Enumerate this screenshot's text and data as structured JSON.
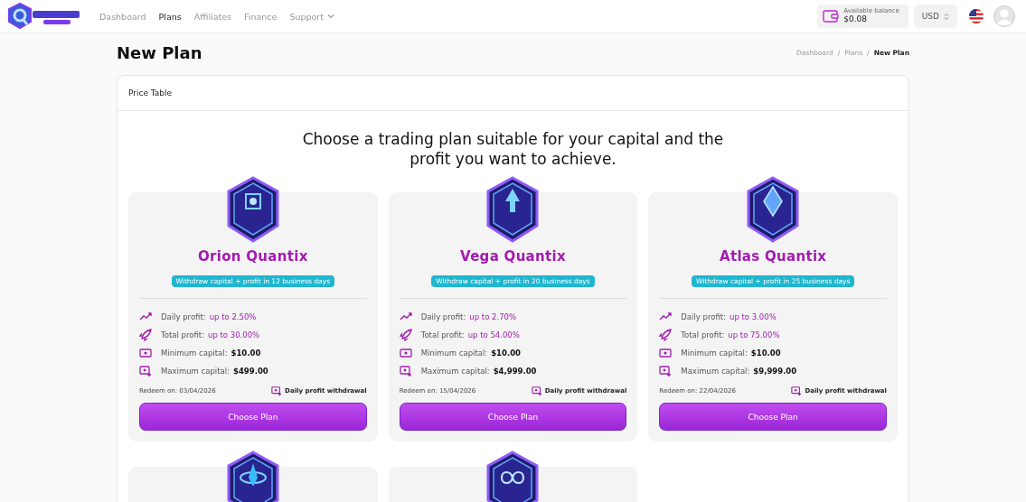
{
  "nav": {
    "items": [
      {
        "label": "Dashboard",
        "selected": false,
        "dropdown": false
      },
      {
        "label": "Plans",
        "selected": true,
        "dropdown": false
      },
      {
        "label": "Affiliates",
        "selected": false,
        "dropdown": false
      },
      {
        "label": "Finance",
        "selected": false,
        "dropdown": false
      },
      {
        "label": "Support",
        "selected": false,
        "dropdown": true
      }
    ],
    "balance": {
      "label": "Available balance",
      "value": "$0.08"
    },
    "currency": "USD"
  },
  "page": {
    "title": "New Plan",
    "breadcrumb": [
      {
        "label": "Dashboard",
        "selected": false
      },
      {
        "separator": "/",
        "label": "Plans",
        "selected": false
      },
      {
        "separator": "/",
        "label": "New Plan",
        "selected": true
      }
    ]
  },
  "price_table": {
    "title": "Price Table",
    "heading": "Choose a trading plan suitable for your capital and the profit you want to achieve.",
    "plans": [
      {
        "kind": "cube",
        "name": "Orion Quantix",
        "note": "Withdraw capital + profit in 12 business days",
        "details": [
          {
            "kind": "trend",
            "label": "Daily profit:",
            "value": "up to 2.50%",
            "accent": true
          },
          {
            "kind": "rocket",
            "label": "Total profit:",
            "value": "up to 30.00%",
            "accent": true
          },
          {
            "kind": "cash",
            "label": "Minimum capital:",
            "value": "$10.00",
            "accent": false
          },
          {
            "kind": "cash-plus",
            "label": "Maximum capital:",
            "value": "$499.00",
            "accent": false
          }
        ],
        "redeem": "Redeem on: 03/04/2026",
        "withdrawal": "Daily profit withdrawal",
        "button": "Choose Plan"
      },
      {
        "kind": "arrow",
        "name": "Vega Quantix",
        "note": "Withdraw capital + profit in 20 business days",
        "details": [
          {
            "kind": "trend",
            "label": "Daily profit:",
            "value": "up to 2.70%",
            "accent": true
          },
          {
            "kind": "rocket",
            "label": "Total profit:",
            "value": "up to 54.00%",
            "accent": true
          },
          {
            "kind": "cash",
            "label": "Minimum capital:",
            "value": "$10.00",
            "accent": false
          },
          {
            "kind": "cash-plus",
            "label": "Maximum capital:",
            "value": "$4,999.00",
            "accent": false
          }
        ],
        "redeem": "Redeem on: 15/04/2026",
        "withdrawal": "Daily profit withdrawal",
        "button": "Choose Plan"
      },
      {
        "kind": "crystal",
        "name": "Atlas Quantix",
        "note": "Withdraw capital + profit in 25 business days",
        "details": [
          {
            "kind": "trend",
            "label": "Daily profit:",
            "value": "up to 3.00%",
            "accent": true
          },
          {
            "kind": "rocket",
            "label": "Total profit:",
            "value": "up to 75.00%",
            "accent": true
          },
          {
            "kind": "cash",
            "label": "Minimum capital:",
            "value": "$10.00",
            "accent": false
          },
          {
            "kind": "cash-plus",
            "label": "Maximum capital:",
            "value": "$9,999.00",
            "accent": false
          }
        ],
        "redeem": "Redeem on: 22/04/2026",
        "withdrawal": "Daily profit withdrawal",
        "button": "Choose Plan"
      },
      {
        "kind": "orbit"
      },
      {
        "kind": "infinity"
      }
    ]
  }
}
